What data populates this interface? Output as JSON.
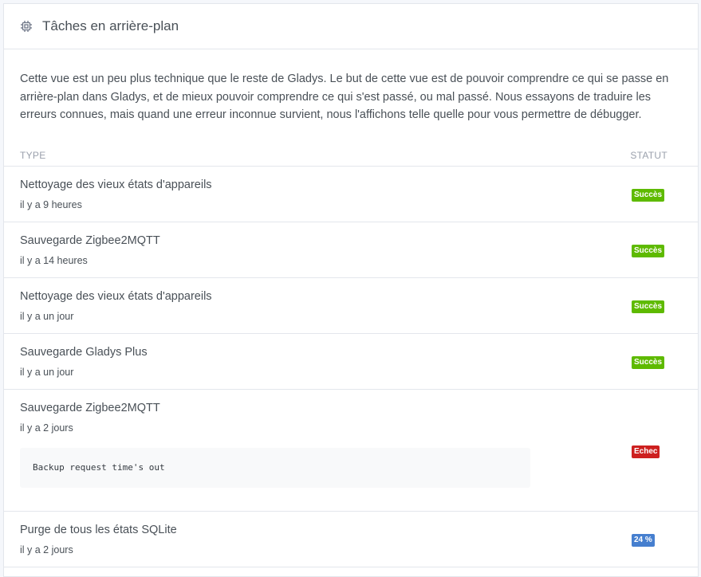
{
  "header": {
    "title": "Tâches en arrière-plan",
    "icon": "cpu-icon"
  },
  "intro": "Cette vue est un peu plus technique que le reste de Gladys. Le but de cette vue est de pouvoir comprendre ce qui se passe en arrière-plan dans Gladys, et de mieux pouvoir comprendre ce qui s'est passé, ou mal passé. Nous essayons de traduire les erreurs connues, mais quand une erreur inconnue survient, nous l'affichons telle quelle pour vous permettre de débugger.",
  "table": {
    "col_type": "TYPE",
    "col_status": "STATUT",
    "rows": [
      {
        "name": "Nettoyage des vieux états d'appareils",
        "time": "il y a 9 heures",
        "status": "Succès",
        "status_color": "#5eba00"
      },
      {
        "name": "Sauvegarde Zigbee2MQTT",
        "time": "il y a 14 heures",
        "status": "Succès",
        "status_color": "#5eba00"
      },
      {
        "name": "Nettoyage des vieux états d'appareils",
        "time": "il y a un jour",
        "status": "Succès",
        "status_color": "#5eba00"
      },
      {
        "name": "Sauvegarde Gladys Plus",
        "time": "il y a un jour",
        "status": "Succès",
        "status_color": "#5eba00"
      },
      {
        "name": "Sauvegarde Zigbee2MQTT",
        "time": "il y a 2 jours",
        "error": "Backup request time's out",
        "status": "Echec",
        "status_color": "#cd201f"
      },
      {
        "name": "Purge de tous les états SQLite",
        "time": "il y a 2 jours",
        "status": "24 %",
        "status_color": "#467fcf"
      }
    ]
  }
}
